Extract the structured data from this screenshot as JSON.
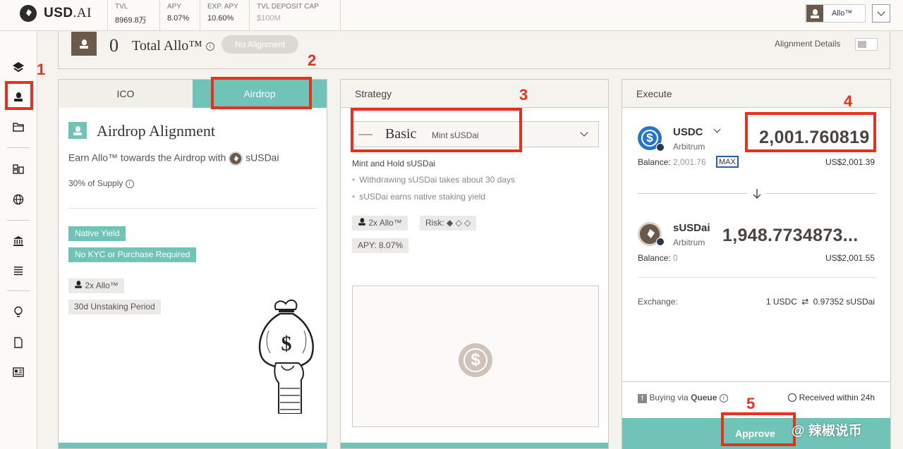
{
  "header": {
    "logo_text": "USD",
    "logo_suffix": ".AI",
    "stats": [
      {
        "label": "TVL",
        "value": "8969.8万"
      },
      {
        "label": "APY",
        "value": "8.07%"
      },
      {
        "label": "EXP. APY",
        "value": "10.60%"
      },
      {
        "label": "TVL DEPOSIT CAP",
        "value": "$100M"
      }
    ],
    "account_label": "Allo™"
  },
  "alignment": {
    "total_value": "0",
    "total_label": "Total Allo™",
    "status_pill": "No Alignment",
    "details_label": "Alignment Details"
  },
  "left_panel": {
    "tabs": [
      {
        "label": "ICO"
      },
      {
        "label": "Airdrop"
      }
    ],
    "title": "Airdrop Alignment",
    "earn_text": "Earn Allo™ towards the Airdrop with",
    "earn_token": "sUSDai",
    "supply_text": "30% of Supply",
    "tags": [
      "Native Yield",
      "No KYC or Purchase Required"
    ],
    "multiplier": "2x Allo™",
    "unstaking": "30d Unstaking Period"
  },
  "middle_panel": {
    "header": "Strategy",
    "strategy_name": "Basic",
    "strategy_sub": "Mint sUSDai",
    "desc_title": "Mint and Hold sUSDai",
    "bullets": [
      "Withdrawing sUSDai takes about 30 days",
      "sUSDai earns native staking yield"
    ],
    "multiplier": "2x Allo™",
    "risk_label": "Risk:",
    "risk_symbols": "◆ ◇ ◇",
    "apy": "APY: 8.07%"
  },
  "right_panel": {
    "header": "Execute",
    "from_token": "USDC",
    "from_network": "Arbitrum",
    "from_amount": "2,001.760819",
    "balance_label": "Balance:",
    "from_balance": "2,001.76",
    "max_label": "MAX",
    "from_usd": "US$2,001.39",
    "to_token": "sUSDai",
    "to_network": "Arbitrum",
    "to_amount": "1,948.7734873...",
    "to_balance": "0",
    "to_usd": "US$2,001.55",
    "exchange_label": "Exchange:",
    "exchange_from": "1 USDC",
    "exchange_to": "0.97352 sUSDai",
    "buying_prefix": "Buying via",
    "buying_method": "Queue",
    "received": "Received within 24h",
    "approve_label": "Approve"
  },
  "annotations": [
    "1",
    "2",
    "3",
    "4",
    "5"
  ],
  "watermark": "@ 辣椒说币",
  "colors": {
    "teal": "#6fc3b7",
    "brown": "#6b5a4a",
    "red": "#e8311c",
    "usdc": "#2775ca"
  }
}
